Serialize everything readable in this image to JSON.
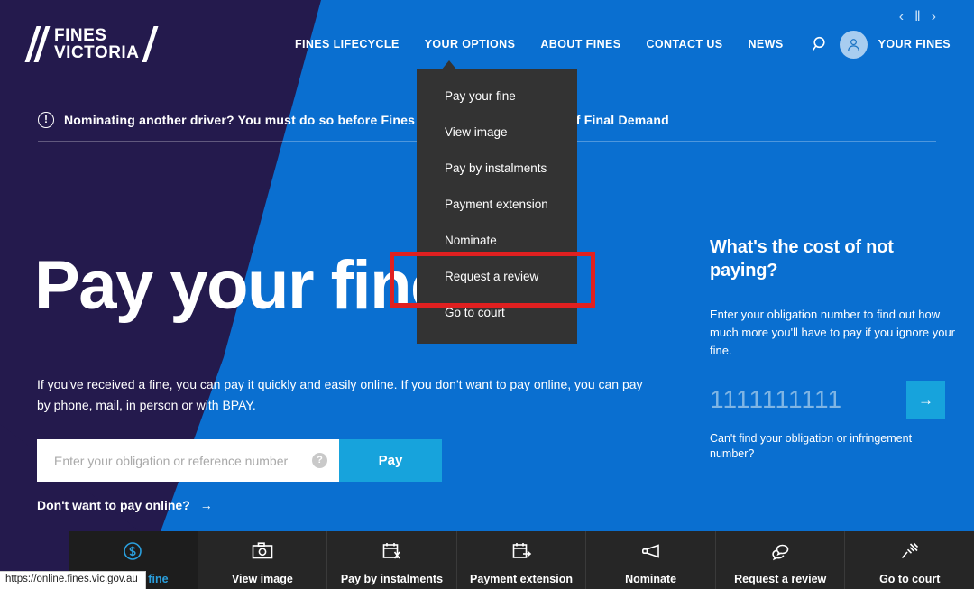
{
  "site": {
    "logo_line1": "FINES",
    "logo_line2": "VICTORIA"
  },
  "header": {
    "nav_items": [
      {
        "label": "FINES LIFECYCLE"
      },
      {
        "label": "YOUR OPTIONS"
      },
      {
        "label": "ABOUT FINES"
      },
      {
        "label": "CONTACT US"
      },
      {
        "label": "NEWS"
      }
    ],
    "search_icon": "search-icon",
    "account_icon": "user-avatar-icon",
    "your_fines_label": "YOUR FINES"
  },
  "dropdown": {
    "parent": "YOUR OPTIONS",
    "items": [
      {
        "label": "Pay your fine"
      },
      {
        "label": "View image"
      },
      {
        "label": "Pay by instalments"
      },
      {
        "label": "Payment extension"
      },
      {
        "label": "Nominate"
      },
      {
        "label": "Request a review"
      },
      {
        "label": "Go to court"
      }
    ],
    "highlighted_item": "Request a review"
  },
  "banner": {
    "icon": "exclamation-circle-icon",
    "text": "Nominating another driver? You must do so before Fines Victoria issues a Notice of Final Demand",
    "prev_icon": "chevron-left-icon",
    "pause_icon": "pause-icon",
    "next_icon": "chevron-right-icon"
  },
  "hero": {
    "title": "Pay your fine",
    "body": "If you've received a fine, you can pay it quickly and easily online. If you don't want to pay online, you can pay by phone, mail, in person or with BPAY.",
    "input_placeholder": "Enter your obligation or reference number",
    "input_value": "",
    "help_icon": "question-mark-icon",
    "pay_button": "Pay",
    "alt_link": "Don't want to pay online?",
    "alt_link_icon": "arrow-right-icon"
  },
  "cost_panel": {
    "title": "What's the cost of not paying?",
    "body": "Enter your obligation number to find out how much more you'll have to pay if you ignore your fine.",
    "input_placeholder": "1111111111",
    "input_value": "",
    "submit_icon": "arrow-right-icon",
    "help_link": "Can't find your obligation or infringement number?"
  },
  "tiles": [
    {
      "label": "Pay your fine",
      "icon": "dollar-coin-icon",
      "active": true
    },
    {
      "label": "View image",
      "icon": "camera-icon",
      "active": false
    },
    {
      "label": "Pay by instalments",
      "icon": "calendar-instalments-icon",
      "active": false
    },
    {
      "label": "Payment extension",
      "icon": "calendar-extension-icon",
      "active": false
    },
    {
      "label": "Nominate",
      "icon": "megaphone-icon",
      "active": false
    },
    {
      "label": "Request a review",
      "icon": "speech-bubbles-icon",
      "active": false
    },
    {
      "label": "Go to court",
      "icon": "gavel-icon",
      "active": false
    }
  ],
  "status_bar": {
    "url": "https://online.fines.vic.gov.au"
  },
  "colors": {
    "purple": "#241a4d",
    "blue": "#0a6fd0",
    "accent_cyan": "#17a3dc",
    "dropdown_bg": "#333333",
    "tile_bg": "#262626",
    "highlight_red": "#e02020"
  }
}
